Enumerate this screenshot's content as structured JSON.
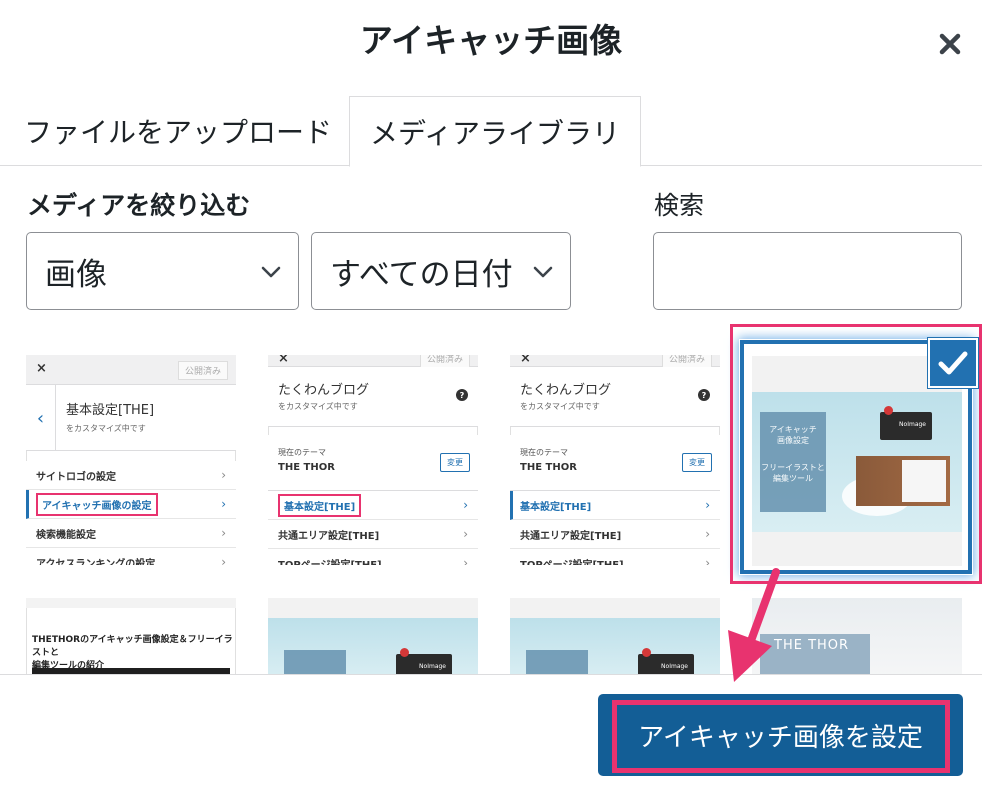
{
  "modal": {
    "title": "アイキャッチ画像",
    "close_icon": "close-icon"
  },
  "tabs": [
    {
      "label": "ファイルをアップロード",
      "active": false
    },
    {
      "label": "メディアライブラリ",
      "active": true
    }
  ],
  "filters": {
    "label": "メディアを絞り込む",
    "type_select": {
      "selected": "画像"
    },
    "date_select": {
      "selected": "すべての日付"
    }
  },
  "search": {
    "label": "検索",
    "value": ""
  },
  "thumbnails": {
    "t1": {
      "close": "×",
      "publish": "公開済み",
      "header_title": "基本設定[THE]",
      "header_sub": "をカスタマイズ中です",
      "rows": [
        "サイトロゴの設定",
        "アイキャッチ画像の設定",
        "検索機能設定",
        "アクセスランキングの設定"
      ]
    },
    "t2": {
      "close": "×",
      "publish": "公開済み",
      "header_title": "たくわんブログ",
      "header_sub": "をカスタマイズ中です",
      "theme_label": "現在のテーマ",
      "theme_name": "THE THOR",
      "change": "変更",
      "rows": [
        "基本設定[THE]",
        "共通エリア設定[THE]",
        "TOPページ設定[THE]"
      ]
    },
    "t3": {
      "close": "×",
      "publish": "公開済み",
      "header_title": "たくわんブログ",
      "header_sub": "をカスタマイズ中です",
      "theme_label": "現在のテーマ",
      "theme_name": "THE THOR",
      "change": "変更",
      "rows": [
        "基本設定[THE]",
        "共通エリア設定[THE]",
        "TOPページ設定[THE]"
      ]
    },
    "t4": {
      "panel_line1": "アイキャッチ",
      "panel_line2": "画像設定",
      "panel_line3": "フリーイラストと",
      "panel_line4": "編集ツール",
      "badge": "NoImage",
      "selected": true
    },
    "t5": {
      "article_title_1": "THETHORのアイキャッチ画像設定＆フリーイラストと",
      "article_title_2": "編集ツールの紹介"
    },
    "t6": {
      "badge": "NoImage"
    },
    "t7": {
      "badge": "NoImage"
    },
    "t8": {
      "brand": "THE THOR"
    }
  },
  "footer": {
    "primary_button": "アイキャッチ画像を設定"
  },
  "colors": {
    "primary": "#135e96",
    "selection": "#2271b1",
    "highlight": "#e8336f"
  }
}
